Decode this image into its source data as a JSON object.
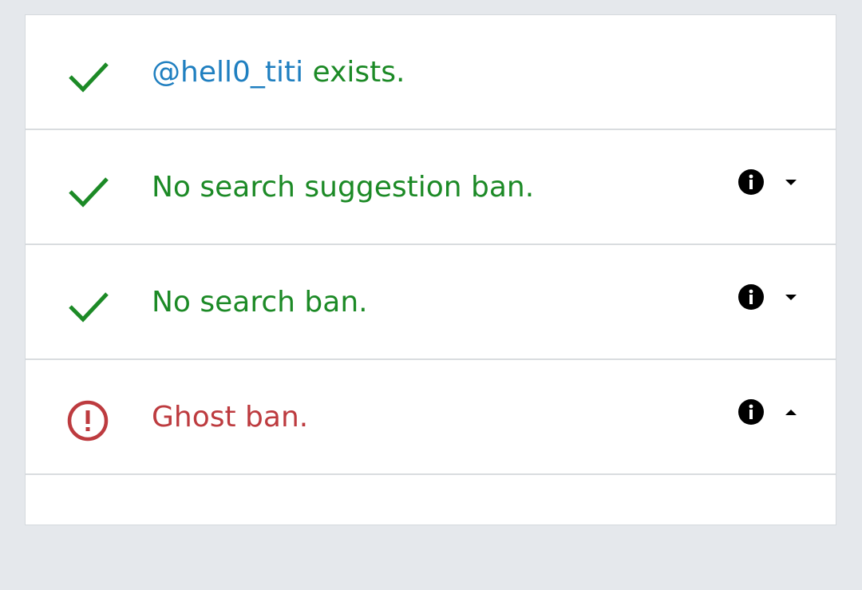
{
  "colors": {
    "success": "#1c8a26",
    "error": "#bd3b3f",
    "handle": "#1f7fc0",
    "icon": "#000000",
    "background": "#e5e8ec",
    "divider": "#d9dcdf"
  },
  "results": [
    {
      "status": "success",
      "status_icon": "check-icon",
      "handle": "@hell0_titi",
      "text": " exists."
    },
    {
      "status": "success",
      "status_icon": "check-icon",
      "text": "No search suggestion ban.",
      "info_icon": "info-icon",
      "toggle_icon": "chevron-down-icon"
    },
    {
      "status": "success",
      "status_icon": "check-icon",
      "text": "No search ban.",
      "info_icon": "info-icon",
      "toggle_icon": "chevron-down-icon"
    },
    {
      "status": "error",
      "status_icon": "exclamation-circle-icon",
      "text": "Ghost ban.",
      "info_icon": "info-icon",
      "toggle_icon": "chevron-up-icon"
    }
  ]
}
